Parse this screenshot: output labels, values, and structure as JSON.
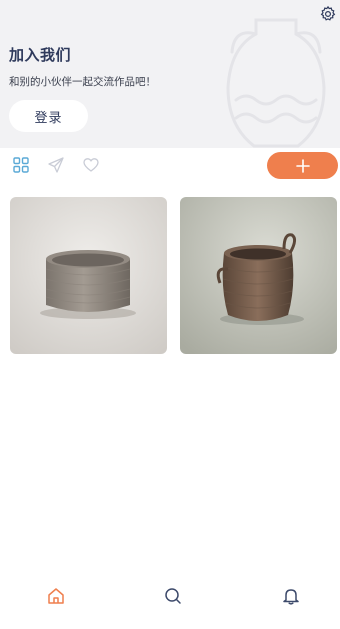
{
  "header": {
    "join_title": "加入我们",
    "join_subtitle": "和别的小伙伴一起交流作品吧！",
    "login_label": "登录",
    "settings_icon": "gear-icon"
  },
  "tabs": [
    {
      "icon": "grid-icon",
      "active": true
    },
    {
      "icon": "paper-plane-icon",
      "active": false
    },
    {
      "icon": "heart-icon",
      "active": false
    }
  ],
  "add_button": {
    "icon": "plus-icon"
  },
  "gallery": [
    {
      "subject": "clay-cylinder-pot"
    },
    {
      "subject": "clay-pot-with-handles"
    }
  ],
  "bottom_nav": [
    {
      "icon": "home-icon",
      "active": true
    },
    {
      "icon": "search-icon",
      "active": false
    },
    {
      "icon": "bell-icon",
      "active": false
    }
  ],
  "colors": {
    "accent": "#ef7f4d",
    "tab_active": "#5aa9d6",
    "tab_inactive": "#c9ccd6",
    "title_text": "#2f3a5c",
    "header_bg": "#f2f2f4"
  }
}
